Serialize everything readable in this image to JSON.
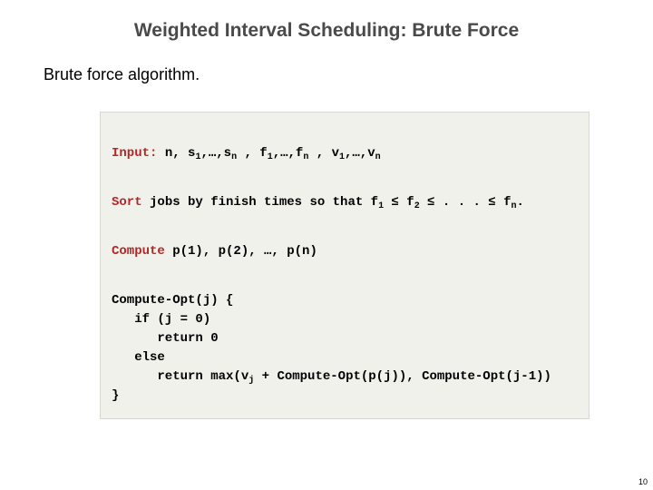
{
  "title": "Weighted Interval Scheduling:  Brute Force",
  "subhead": "Brute force algorithm.",
  "code": {
    "input_kw": "Input:",
    "input_rest_a": " n, s",
    "sub1": "1",
    "input_rest_b": ",…,s",
    "subn": "n",
    "comma_sp": " , ",
    "f_a": "f",
    "f_b": ",…,f",
    "v_a": "v",
    "v_b": ",…,v",
    "sort_kw": "Sort",
    "sort_rest": " jobs by finish times so that f",
    "sort_mid1": " ≤ f",
    "sub2": "2",
    "sort_tail": " ≤ . . . ≤ f",
    "sort_end": ".",
    "compute_kw": "Compute",
    "compute_rest": " p(1), p(2), …, p(n)",
    "fn_l1": "Compute-Opt(j) {",
    "fn_l2": "   if (j = 0)",
    "fn_l3": "      return 0",
    "fn_l4": "   else",
    "fn_l5a": "      return max(v",
    "subj": "j",
    "fn_l5b": " + Compute-Opt(p(j)), Compute-Opt(j-1))",
    "fn_l6": "}"
  },
  "pagenum": "10"
}
